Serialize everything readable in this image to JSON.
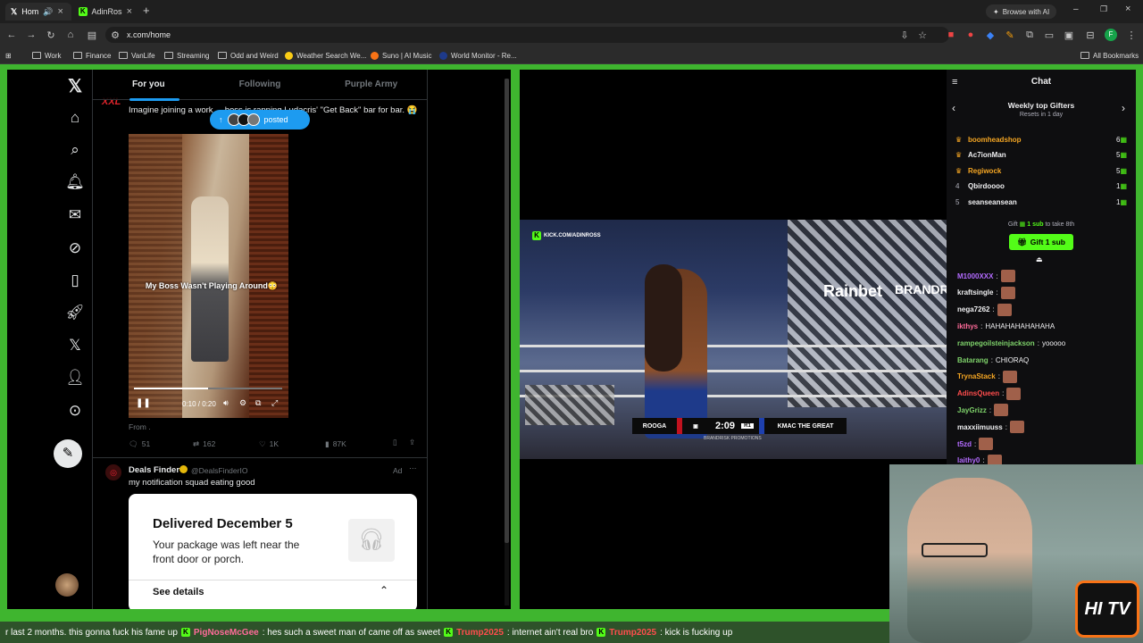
{
  "browser": {
    "tabs": [
      {
        "label": "Hom"
      },
      {
        "label": "AdinRos"
      }
    ],
    "browse_ai": "Browse with AI",
    "url": "x.com/home",
    "bookmarks": [
      "Work",
      "Finance",
      "VanLife",
      "Streaming",
      "Odd and Weird",
      "Weather Search We...",
      "Suno | AI Music",
      "World Monitor - Re..."
    ],
    "all_bookmarks": "All Bookmarks"
  },
  "x": {
    "tabs": [
      "For you",
      "Following",
      "Purple Army"
    ],
    "tweet1": {
      "avatar": "XXL",
      "text": "Imagine joining a work ... boss is rapping Ludacris' \"Get Back\" bar for bar. 😭",
      "posted": "posted",
      "video_caption": "My Boss Wasn't Playing Around😳",
      "time": "0:10 / 0:20",
      "from": "From .",
      "replies": "51",
      "reposts": "162",
      "likes": "1K",
      "views": "87K"
    },
    "tweet2": {
      "name": "Deals Finder",
      "handle": "@DealsFinderIO",
      "ad": "Ad",
      "text": "my notification squad eating good",
      "card_title": "Delivered December 5",
      "card_body": "Your package was left near the front door or porch.",
      "card_link": "See details"
    }
  },
  "stream": {
    "watermark": "KICK.COM/ADINROSS",
    "fighter_left": "ROOGA",
    "clock": "2:09",
    "round": "R1",
    "fighter_right": "KMAC THE GREAT",
    "promo": "BRANDRISK PROMOTIONS",
    "banner": "Rainbet",
    "banner2": "BRANDRI"
  },
  "chat": {
    "title": "Chat",
    "gifters_title": "Weekly top Gifters",
    "gifters_sub": "Resets in 1 day",
    "gifters": [
      {
        "rank": "",
        "name": "boomheadshop",
        "count": "6",
        "color": "#f5a623"
      },
      {
        "rank": "",
        "name": "Ac7ionMan",
        "count": "5",
        "color": "#efeff1"
      },
      {
        "rank": "",
        "name": "Regiwock",
        "count": "5",
        "color": "#f5a623"
      },
      {
        "rank": "4",
        "name": "Qbirdoooo",
        "count": "1",
        "color": "#efeff1"
      },
      {
        "rank": "5",
        "name": "seanseansean",
        "count": "1",
        "color": "#efeff1"
      }
    ],
    "gift_line_a": "Gift",
    "gift_line_b": "1 sub",
    "gift_line_c": "to take 8th",
    "gift_button": "Gift 1 sub",
    "messages": [
      {
        "user": "M1000XXX",
        "color": "#b36bff",
        "text": ""
      },
      {
        "user": "kraftsingle",
        "color": "#efeff1",
        "text": ""
      },
      {
        "user": "nega7262",
        "color": "#efeff1",
        "text": ""
      },
      {
        "user": "ikthys",
        "color": "#ff6b9a",
        "text": "HAHAHAHAHAHAHA"
      },
      {
        "user": "rampegoilsteinjackson",
        "color": "#7fd36b",
        "text": "yooooo"
      },
      {
        "user": "Batarang",
        "color": "#7fd36b",
        "text": "CHIORAQ"
      },
      {
        "user": "TrynaStack",
        "color": "#f5a623",
        "text": ""
      },
      {
        "user": "AdinsQueen",
        "color": "#ff4d4d",
        "text": ""
      },
      {
        "user": "JayGrizz",
        "color": "#7fd36b",
        "text": ""
      },
      {
        "user": "maxxiimuuss",
        "color": "#efeff1",
        "text": ""
      },
      {
        "user": "t5zd",
        "color": "#b36bff",
        "text": ""
      },
      {
        "user": "laithy0",
        "color": "#b36bff",
        "text": ""
      }
    ]
  },
  "overlay": {
    "logo": "HI TV"
  },
  "ticker": [
    {
      "user": "",
      "text": "r last 2 months. this gonna fuck his fame up"
    },
    {
      "user": "PigNoseMcGee",
      "text": ": hes such a sweet man of came off as sweet"
    },
    {
      "user": "Trump2025",
      "text": ": internet ain't real bro"
    },
    {
      "user": "Trump2025",
      "text": ": kick is fucking up"
    }
  ]
}
